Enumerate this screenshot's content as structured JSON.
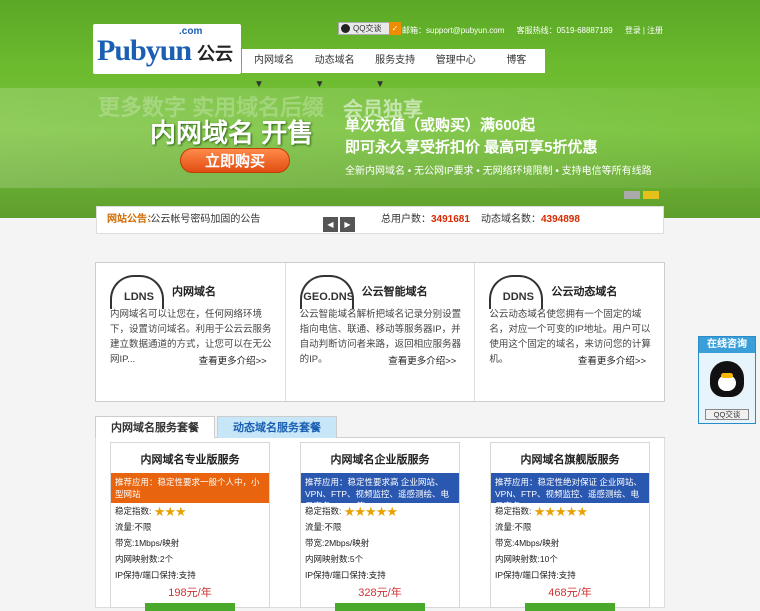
{
  "header": {
    "logo_word": "Pubyun",
    "logo_dotcom": ".com",
    "logo_cn": "公云",
    "qq_label": "QQ交谈",
    "email_label": "邮箱：support@pubyun.com",
    "hotline_label": "客服热线：0519-68887189",
    "login": "登录",
    "register": "注册"
  },
  "nav": {
    "items": [
      {
        "label": "内网域名▼"
      },
      {
        "label": "动态域名▼"
      },
      {
        "label": "服务支持▼"
      },
      {
        "label": "管理中心"
      },
      {
        "label": "博客"
      }
    ]
  },
  "hero": {
    "ghost_text": "更多数字  实用域名后缀",
    "title": "内网域名 开售",
    "buy_button": "立即购买",
    "promo_top": "会员独享",
    "promo_line1": "单次充值（或购买）满600起",
    "promo_line2": "即可永久享受折扣价 最高可享5折优惠",
    "promo_line3": "全新内网域名 • 无公网IP要求 • 无网络环境限制 • 支持电信等所有线路"
  },
  "notice": {
    "label": "网站公告：",
    "text": "·公云帐号密码加固的公告",
    "prev": "◀",
    "next": "▶",
    "total_users_label": "总用户数：",
    "total_users": "3491681",
    "dyn_domains_label": "动态域名数：",
    "dyn_domains": "4394898"
  },
  "features": [
    {
      "logo": "LDNS",
      "icon": "ldns-cloud-icon",
      "title": "内网域名",
      "desc": "内网域名可以让您在，任何网络环境下，设置访问域名。利用于公云云服务建立数据通道的方式，让您可以在无公网IP...",
      "more": "查看更多介绍>>"
    },
    {
      "logo": "GEO.DNS",
      "icon": "geodns-cloud-icon",
      "title": "公云智能域名",
      "desc": "公云智能域名解析把域名记录分别设置指向电信、联通、移动等服务器IP，并自动判断访问者来路，返回相应服务器的IP。",
      "more": "查看更多介绍>>"
    },
    {
      "logo": "DDNS",
      "icon": "ddns-cloud-icon",
      "title": "公云动态域名",
      "desc": "公云动态域名使您拥有一个固定的域名，对应一个可变的IP地址。用户可以使用这个固定的域名，来访问您的计算机。",
      "more": "查看更多介绍>>"
    }
  ],
  "tabs": [
    {
      "label": "内网域名服务套餐"
    },
    {
      "label": "动态域名服务套餐"
    }
  ],
  "packages": [
    {
      "title": "内网域名专业版服务",
      "rec": "推荐应用：稳定性要求一般个人中，小型网站",
      "rec_color": "#e8640e",
      "stab_label": "稳定指数:",
      "stars": "★★★",
      "traffic": "流量:不限",
      "bw": "带宽:1Mbps/映射",
      "maps": "内网映射数:2个",
      "ip": "IP保持/端口保持:支持",
      "price": "198元/年"
    },
    {
      "title": "内网域名企业版服务",
      "rec": "推荐应用：稳定性要求高 企业网站、VPN、FTP、视频监控、遥感测绘、电子商务、ERP等",
      "rec_color": "#2a57b0",
      "stab_label": "稳定指数:",
      "stars": "★★★★★",
      "traffic": "流量:不限",
      "bw": "带宽:2Mbps/映射",
      "maps": "内网映射数:5个",
      "ip": "IP保持/端口保持:支持",
      "price": "328元/年"
    },
    {
      "title": "内网域名旗舰版服务",
      "rec": "推荐应用：稳定性绝对保证 企业网站、VPN、FTP、视频监控、遥感测绘、电子商务...",
      "rec_color": "#2a57b0",
      "stab_label": "稳定指数:",
      "stars": "★★★★★",
      "traffic": "流量:不限",
      "bw": "带宽:4Mbps/映射",
      "maps": "内网映射数:10个",
      "ip": "IP保持/端口保持:支持",
      "price": "468元/年"
    }
  ],
  "online": {
    "header": "在线咨询",
    "qq_label": "QQ交谈"
  }
}
